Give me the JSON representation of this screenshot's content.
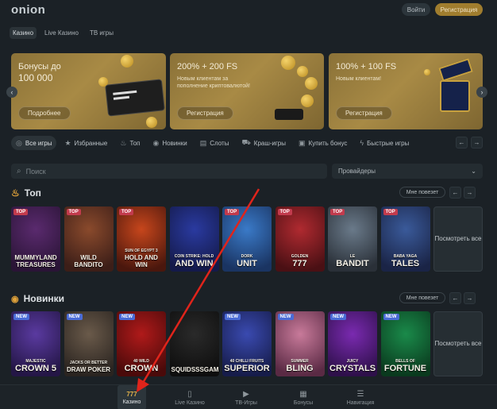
{
  "header": {
    "logo": "onion",
    "login_label": "Войти",
    "register_label": "Регистрация"
  },
  "top_tabs": [
    {
      "label": "Казино",
      "active": true
    },
    {
      "label": "Live Казино",
      "active": false
    },
    {
      "label": "ТВ игры",
      "active": false
    }
  ],
  "banners": [
    {
      "title_line1": "Бонусы до",
      "title_line2": "100 000",
      "sub": "",
      "button": "Подробнее"
    },
    {
      "title_line1": "200% + 200 FS",
      "title_line2": "",
      "sub": "Новым клиентам за пополнение криптовалютой!",
      "button": "Регистрация"
    },
    {
      "title_line1": "100% + 100 FS",
      "title_line2": "",
      "sub": "Новым клиентам!",
      "button": "Регистрация"
    }
  ],
  "categories": [
    {
      "label": "Все игры",
      "icon": "target-icon",
      "glyph": "◎",
      "active": true
    },
    {
      "label": "Избранные",
      "icon": "star-icon",
      "glyph": "★",
      "active": false
    },
    {
      "label": "Топ",
      "icon": "fire-icon",
      "glyph": "♨",
      "active": false
    },
    {
      "label": "Новинки",
      "icon": "new-icon",
      "glyph": "◉",
      "active": false
    },
    {
      "label": "Слоты",
      "icon": "slot-icon",
      "glyph": "▤",
      "active": false
    },
    {
      "label": "Краш-игры",
      "icon": "crash-icon",
      "glyph": "⛟",
      "active": false
    },
    {
      "label": "Купить бонус",
      "icon": "bonus-icon",
      "glyph": "▣",
      "active": false
    },
    {
      "label": "Быстрые игры",
      "icon": "lightning-icon",
      "glyph": "ϟ",
      "active": false
    }
  ],
  "search": {
    "placeholder": "Поиск",
    "providers_label": "Провайдеры"
  },
  "top_section": {
    "title": "Топ",
    "lucky_label": "Мне повезет",
    "see_all": "Посмотреть все",
    "games": [
      {
        "badge": "TOP",
        "small": "",
        "name": "MUMMYLAND TREASURES",
        "colors": [
          "#5a2a6e",
          "#2a1436"
        ]
      },
      {
        "badge": "TOP",
        "small": "",
        "name": "WILD BANDITO",
        "colors": [
          "#8a4a2c",
          "#3c1e18"
        ]
      },
      {
        "badge": "TOP",
        "small": "SUN OF EGYPT 3",
        "name": "HOLD AND WIN",
        "colors": [
          "#c7461c",
          "#4a170d"
        ]
      },
      {
        "badge": "",
        "small": "COIN STRIKE: HOLD",
        "name": "AND WIN",
        "colors": [
          "#2a3aa0",
          "#141a4a"
        ]
      },
      {
        "badge": "TOP",
        "small": "DORK",
        "name": "UNIT",
        "colors": [
          "#3a7ac8",
          "#1a3462"
        ]
      },
      {
        "badge": "TOP",
        "small": "GOLDEN",
        "name": "777",
        "colors": [
          "#b02a30",
          "#4a1014"
        ]
      },
      {
        "badge": "TOP",
        "small": "LE",
        "name": "BANDIT",
        "colors": [
          "#6a7a8a",
          "#2a3038"
        ]
      },
      {
        "badge": "TOP",
        "small": "BABA YAGA",
        "name": "TALES",
        "colors": [
          "#3a5a9a",
          "#1a2446"
        ]
      }
    ]
  },
  "new_section": {
    "title": "Новинки",
    "lucky_label": "Мне повезет",
    "see_all": "Посмотреть все",
    "games": [
      {
        "badge": "NEW",
        "small": "MAJESTIC",
        "name": "CROWN 5",
        "colors": [
          "#5a3aa0",
          "#241646"
        ]
      },
      {
        "badge": "NEW",
        "small": "JACKS OR BETTER",
        "name": "DRAW POKER",
        "colors": [
          "#6a5a4a",
          "#2a2420"
        ]
      },
      {
        "badge": "NEW",
        "small": "40 WILD",
        "name": "CROWN",
        "colors": [
          "#b01a1a",
          "#4a0a0a"
        ]
      },
      {
        "badge": "",
        "small": "",
        "name": "SQUIDSSSGAME",
        "colors": [
          "#2a2a2a",
          "#0e0e0e"
        ]
      },
      {
        "badge": "NEW",
        "small": "40 CHILLI FRUITS",
        "name": "SUPERIOR",
        "colors": [
          "#3a4ab0",
          "#161c4a"
        ]
      },
      {
        "badge": "NEW",
        "small": "SUMMER",
        "name": "BLING",
        "colors": [
          "#c87a9a",
          "#5a2a44"
        ]
      },
      {
        "badge": "NEW",
        "small": "JUICY",
        "name": "CRYSTALS",
        "colors": [
          "#7a2ab0",
          "#2e104a"
        ]
      },
      {
        "badge": "NEW",
        "small": "BELLS OF",
        "name": "FORTUNE",
        "colors": [
          "#1a8a4a",
          "#0a3a1e"
        ]
      }
    ]
  },
  "bottom_nav": [
    {
      "label": "Казино",
      "icon": "casino-icon",
      "glyph": "777",
      "active": true
    },
    {
      "label": "Live Казино",
      "icon": "cards-icon",
      "glyph": "🂠",
      "active": false
    },
    {
      "label": "ТВ-Игры",
      "icon": "tv-icon",
      "glyph": "▶",
      "active": false
    },
    {
      "label": "Бонусы",
      "icon": "gift-icon",
      "glyph": "⌂",
      "active": false
    },
    {
      "label": "Навигация",
      "icon": "menu-search-icon",
      "glyph": "☰",
      "active": false
    }
  ],
  "colors": {
    "accent": "#a07d2e",
    "annotation_arrow": "#e0241b",
    "bg": "#1b2126"
  }
}
